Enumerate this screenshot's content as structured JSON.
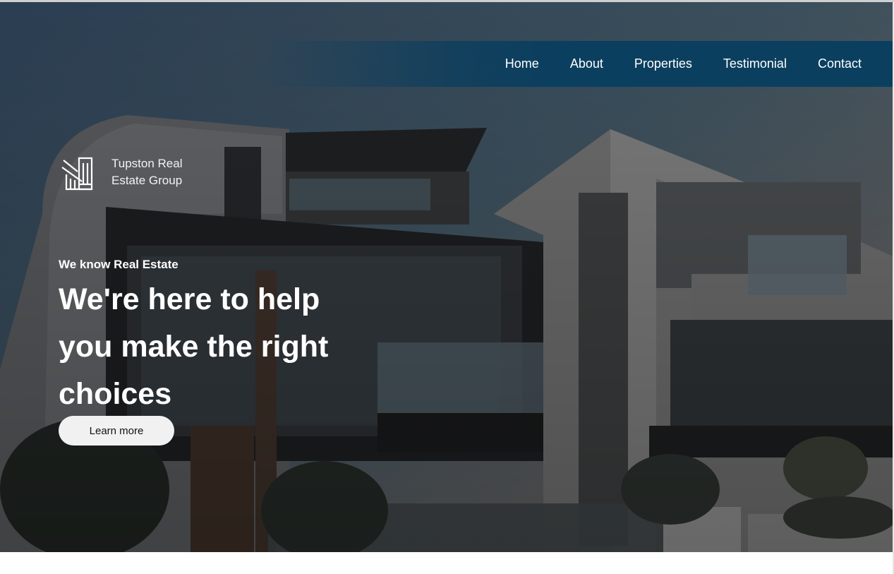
{
  "nav": {
    "items": [
      "Home",
      "About",
      "Properties",
      "Testimonial",
      "Contact"
    ]
  },
  "logo": {
    "icon": "building-logo-icon",
    "text": "Tupston Real Estate Group"
  },
  "hero": {
    "kicker": "We know Real Estate",
    "headline": "We're here to help you make the right choices",
    "cta_label": "Learn more",
    "background": "modern-house-photo"
  },
  "colors": {
    "nav_bar": "#0b3f5f",
    "overlay": "#2c2d30",
    "text": "#ffffff",
    "button_bg": "#f1f1f1",
    "button_text": "#111111"
  }
}
